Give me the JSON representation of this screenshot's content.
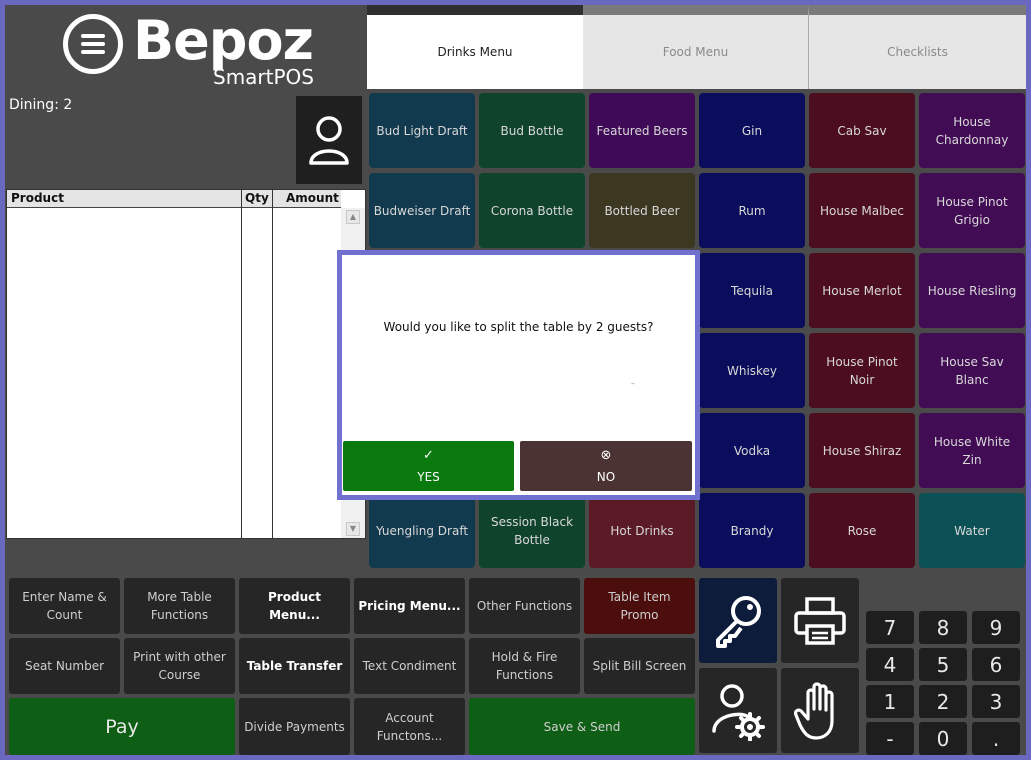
{
  "brand": {
    "name": "Bepoz",
    "sub": "SmartPOS"
  },
  "order": {
    "dining_label": "Dining: 2"
  },
  "product_table": {
    "columns": [
      "Product",
      "Qty",
      "Amount"
    ]
  },
  "tabs": [
    {
      "label": "Drinks Menu",
      "active": true
    },
    {
      "label": "Food Menu",
      "active": false
    },
    {
      "label": "Checklists",
      "active": false
    }
  ],
  "products": [
    {
      "label": "Bud Light Draft",
      "color": "#123a4e"
    },
    {
      "label": "Bud Bottle",
      "color": "#10432c"
    },
    {
      "label": "Featured Beers",
      "color": "#3f0a58"
    },
    {
      "label": "Gin",
      "color": "#0a0d5c"
    },
    {
      "label": "Cab Sav",
      "color": "#4c0d1f"
    },
    {
      "label": "House Chardonnay",
      "color": "#420c55"
    },
    {
      "label": "Budweiser Draft",
      "color": "#123a4e"
    },
    {
      "label": "Corona Bottle",
      "color": "#10432c"
    },
    {
      "label": "Bottled Beer",
      "color": "#3b3721"
    },
    {
      "label": "Rum",
      "color": "#0a0d5c"
    },
    {
      "label": "House Malbec",
      "color": "#4c0d1f"
    },
    {
      "label": "House Pinot Grigio",
      "color": "#420c55"
    },
    {
      "label": "",
      "color": "#123a4e"
    },
    {
      "label": "",
      "color": "#10432c"
    },
    {
      "label": "",
      "color": "#3b3721"
    },
    {
      "label": "Tequila",
      "color": "#0a0d5c"
    },
    {
      "label": "House Merlot",
      "color": "#4c0d1f"
    },
    {
      "label": "House Riesling",
      "color": "#420c55"
    },
    {
      "label": "",
      "color": "#123a4e"
    },
    {
      "label": "",
      "color": "#10432c"
    },
    {
      "label": "",
      "color": "#3b3721"
    },
    {
      "label": "Whiskey",
      "color": "#0a0d5c"
    },
    {
      "label": "House Pinot Noir",
      "color": "#4c0d1f"
    },
    {
      "label": "House Sav Blanc",
      "color": "#420c55"
    },
    {
      "label": "",
      "color": "#123a4e"
    },
    {
      "label": "",
      "color": "#10432c"
    },
    {
      "label": "",
      "color": "#3b3721"
    },
    {
      "label": "Vodka",
      "color": "#0a0d5c"
    },
    {
      "label": "House Shiraz",
      "color": "#4c0d1f"
    },
    {
      "label": "House White Zin",
      "color": "#420c55"
    },
    {
      "label": "Yuengling Draft",
      "color": "#123a4e"
    },
    {
      "label": "Session Black Bottle",
      "color": "#10432c"
    },
    {
      "label": "Hot Drinks",
      "color": "#5a1a26"
    },
    {
      "label": "Brandy",
      "color": "#0a0d5c"
    },
    {
      "label": "Rose",
      "color": "#4c0d1f"
    },
    {
      "label": "Water",
      "color": "#0b5055"
    }
  ],
  "functions": {
    "enter_name": "Enter Name & Count",
    "more_table": "More Table Functions",
    "product_menu": "Product Menu...",
    "pricing_menu": "Pricing Menu...",
    "other_functions": "Other Functions",
    "table_item_promo": "Table Item Promo",
    "seat_number": "Seat Number",
    "print_other_course": "Print with other Course",
    "table_transfer": "Table Transfer",
    "text_condiment": "Text Condiment",
    "hold_fire": "Hold & Fire Functions",
    "split_bill": "Split Bill Screen",
    "pay": "Pay",
    "divide_payments": "Divide Payments",
    "account_functions": "Account Functons...",
    "save_send": "Save & Send"
  },
  "keypad": [
    "7",
    "8",
    "9",
    "4",
    "5",
    "6",
    "1",
    "2",
    "3",
    "-",
    "0",
    "."
  ],
  "dialog": {
    "message": "Would you like to split the table by 2 guests?",
    "tick_mark": "–",
    "yes_label": "YES",
    "yes_icon": "✓",
    "no_label": "NO",
    "no_icon": "⊗"
  },
  "colors": {
    "yes": "#0a7a0f",
    "no": "#4a3332",
    "pay": "#0f5e15",
    "save": "#0f5e15",
    "promo": "#4c0d0d",
    "key_btn": "#0d1c3a",
    "dialog_border": "#7070d0"
  }
}
